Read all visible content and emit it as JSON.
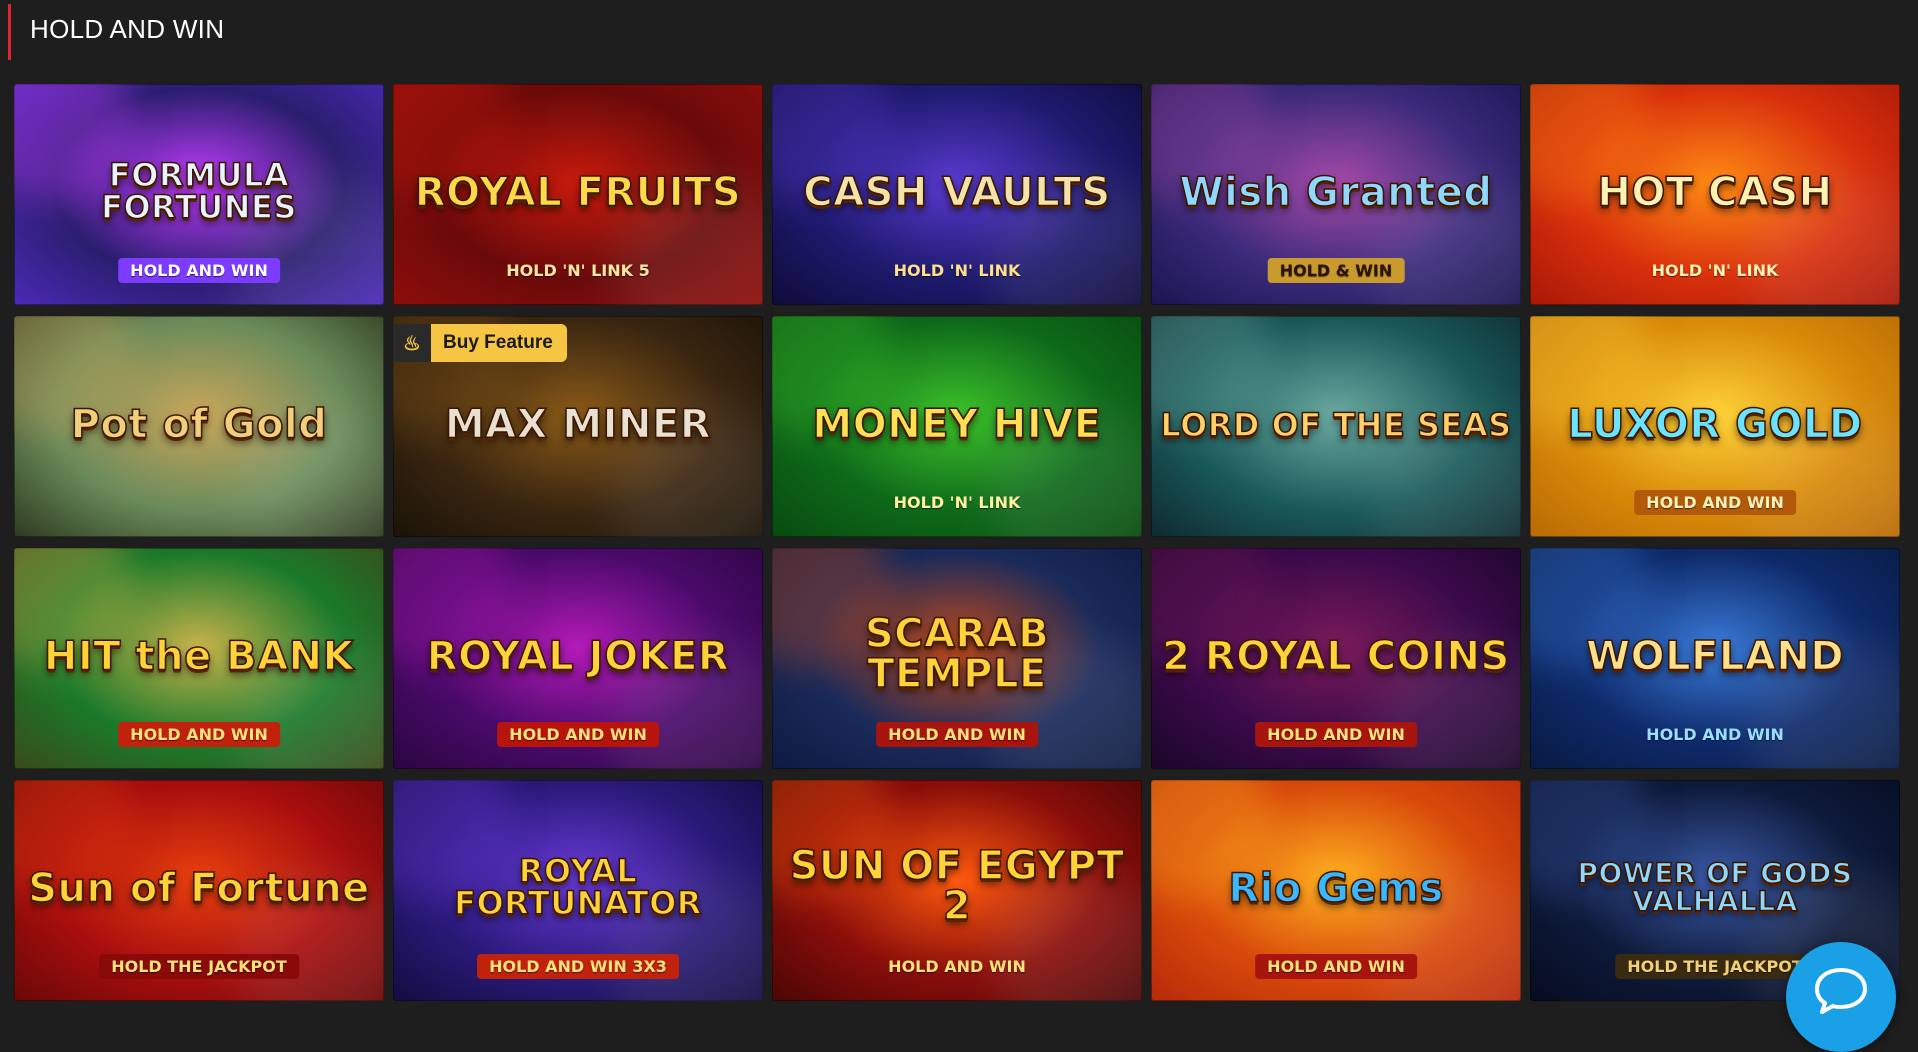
{
  "section": {
    "title": "HOLD AND WIN"
  },
  "badge": {
    "label": "Buy Feature"
  },
  "chat": {
    "icon": "chat-bubble-icon"
  },
  "games": [
    {
      "id": "formula-fortunes",
      "title": "FORMULA FORTUNES",
      "subtitle": "HOLD AND WIN",
      "bg": [
        "#2a1e6e",
        "#c23cff",
        "#4a2ab8"
      ],
      "title_color": "#e9f3ff",
      "sub_bg": "#7b3cff",
      "sub_color": "#ffffff"
    },
    {
      "id": "royal-fruits-5",
      "title": "ROYAL FRUITS",
      "subtitle": "HOLD 'N' LINK 5",
      "bg": [
        "#6a0a0a",
        "#c81a0c",
        "#8e0e0a"
      ],
      "title_color": "#ffd84a",
      "sub_bg": "transparent",
      "sub_color": "#ffe9a0"
    },
    {
      "id": "cash-vaults",
      "title": "CASH VAULTS",
      "subtitle": "HOLD 'N' LINK",
      "bg": [
        "#1e1a6e",
        "#5a3ad0",
        "#0e0b3a"
      ],
      "title_color": "#f4e3a8",
      "sub_bg": "transparent",
      "sub_color": "#ffe08a"
    },
    {
      "id": "wish-granted",
      "title": "Wish Granted",
      "subtitle": "HOLD & WIN",
      "bg": [
        "#3a2a7a",
        "#a54aa8",
        "#1a1550"
      ],
      "title_color": "#8fd8ff",
      "sub_bg": "#c99a2e",
      "sub_color": "#2a1400"
    },
    {
      "id": "hot-cash",
      "title": "HOT CASH",
      "subtitle": "HOLD 'N' LINK",
      "bg": [
        "#d8300c",
        "#ff8a14",
        "#a81808"
      ],
      "title_color": "#fff1b0",
      "sub_bg": "transparent",
      "sub_color": "#fff1b0"
    },
    {
      "id": "pot-of-gold",
      "title": "Pot of Gold",
      "subtitle": "",
      "bg": [
        "#6a8b5a",
        "#c9a65a",
        "#2e3a20"
      ],
      "title_color": "#f1d07a",
      "sub_bg": "transparent",
      "sub_color": "#ffffff"
    },
    {
      "id": "max-miner",
      "title": "MAX MINER",
      "subtitle": "",
      "bg": [
        "#3a2610",
        "#8a5a18",
        "#1a1208"
      ],
      "title_color": "#e8e0d0",
      "sub_bg": "transparent",
      "sub_color": "#ffffff"
    },
    {
      "id": "money-hive",
      "title": "MONEY HIVE",
      "subtitle": "HOLD 'N' LINK",
      "bg": [
        "#0e6a1a",
        "#3cc22a",
        "#084a10"
      ],
      "title_color": "#ffe054",
      "sub_bg": "transparent",
      "sub_color": "#fff2a0"
    },
    {
      "id": "lord-of-the-seas",
      "title": "LORD OF THE SEAS",
      "subtitle": "",
      "bg": [
        "#1a5a5a",
        "#6aa8a0",
        "#0e2a30"
      ],
      "title_color": "#ffcf6a",
      "sub_bg": "transparent",
      "sub_color": "#ffffff"
    },
    {
      "id": "luxor-gold",
      "title": "LUXOR GOLD",
      "subtitle": "HOLD AND WIN",
      "bg": [
        "#d88a08",
        "#ffd23a",
        "#b86a06"
      ],
      "title_color": "#6be2ff",
      "sub_bg": "#b35a0a",
      "sub_color": "#fff2b8"
    },
    {
      "id": "hit-the-bank",
      "title": "HIT the BANK",
      "subtitle": "HOLD AND WIN",
      "bg": [
        "#1a7a2a",
        "#c8b24a",
        "#3a4a1a"
      ],
      "title_color": "#ffd23a",
      "sub_bg": "#c0220e",
      "sub_color": "#ffe27a"
    },
    {
      "id": "royal-joker",
      "title": "ROYAL JOKER",
      "subtitle": "HOLD AND WIN",
      "bg": [
        "#4a0a6a",
        "#b41ab8",
        "#2a0640"
      ],
      "title_color": "#ffd23a",
      "sub_bg": "#b8140e",
      "sub_color": "#ffe27a"
    },
    {
      "id": "scarab-temple",
      "title": "SCARAB TEMPLE",
      "subtitle": "HOLD AND WIN",
      "bg": [
        "#1a2a5a",
        "#c24a1a",
        "#0e1a40"
      ],
      "title_color": "#ffd23a",
      "sub_bg": "#a8140e",
      "sub_color": "#ffe27a"
    },
    {
      "id": "royal-coins-2",
      "title": "2 ROYAL COINS",
      "subtitle": "HOLD AND WIN",
      "bg": [
        "#3a0a4a",
        "#7a1a5a",
        "#1a0628"
      ],
      "title_color": "#ffd23a",
      "sub_bg": "#a8140e",
      "sub_color": "#ffe27a"
    },
    {
      "id": "wolfland",
      "title": "WOLFLAND",
      "subtitle": "HOLD AND WIN",
      "bg": [
        "#0e2a6a",
        "#3a7ad8",
        "#081a40"
      ],
      "title_color": "#ffe08a",
      "sub_bg": "transparent",
      "sub_color": "#9adfff"
    },
    {
      "id": "sun-of-fortune",
      "title": "Sun of Fortune",
      "subtitle": "HOLD THE JACKPOT",
      "bg": [
        "#a80e0e",
        "#e8400e",
        "#6a0808"
      ],
      "title_color": "#ffd23a",
      "sub_bg": "#8a0a0a",
      "sub_color": "#ffe27a"
    },
    {
      "id": "royal-fortunator",
      "title": "ROYAL FORTUNATOR",
      "subtitle": "HOLD AND WIN 3X3",
      "bg": [
        "#2a1a7a",
        "#6a3ad8",
        "#140c40"
      ],
      "title_color": "#ffd23a",
      "sub_bg": "#c0220e",
      "sub_color": "#ffe27a"
    },
    {
      "id": "sun-of-egypt-2",
      "title": "SUN OF EGYPT 2",
      "subtitle": "HOLD AND WIN",
      "bg": [
        "#8a0e0a",
        "#ff5a0e",
        "#4a0606"
      ],
      "title_color": "#ffd23a",
      "sub_bg": "transparent",
      "sub_color": "#ffe27a"
    },
    {
      "id": "rio-gems",
      "title": "Rio Gems",
      "subtitle": "HOLD AND WIN",
      "bg": [
        "#d84a0a",
        "#ffb020",
        "#b82a0a"
      ],
      "title_color": "#3ab8ff",
      "sub_bg": "#a8140e",
      "sub_color": "#ffe27a"
    },
    {
      "id": "power-of-gods-valhalla",
      "title": "POWER OF GODS VALHALLA",
      "subtitle": "HOLD THE JACKPOT",
      "bg": [
        "#0e1a3a",
        "#3a5aa8",
        "#060c20"
      ],
      "title_color": "#8ed8ff",
      "sub_bg": "#3a2a10",
      "sub_color": "#f1d07a"
    }
  ]
}
